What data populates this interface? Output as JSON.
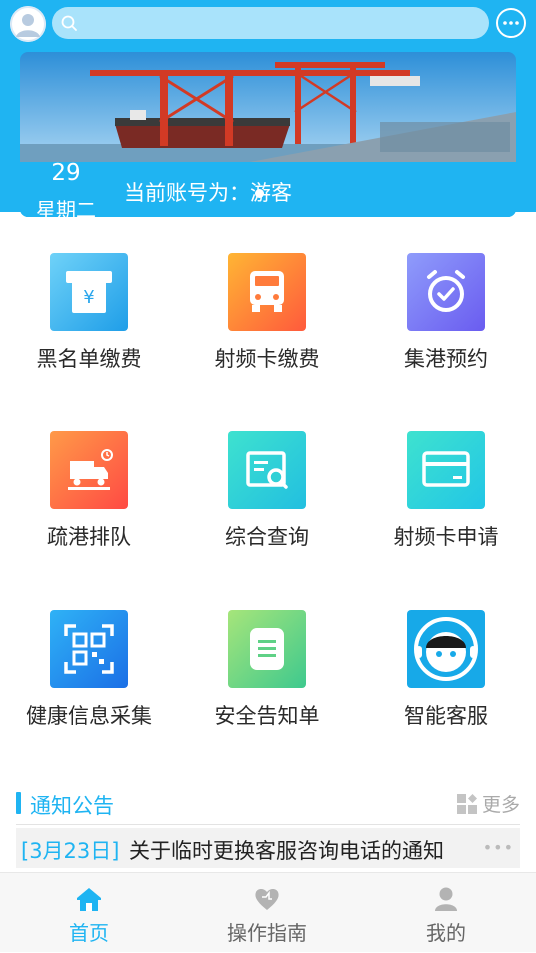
{
  "header": {
    "avatar_icon": "user-avatar-icon",
    "search": {
      "placeholder": "",
      "icon": "search-icon"
    },
    "message_icon": "chat-bubble-icon"
  },
  "banner": {
    "image": "port-crane-ship-photo",
    "date_day": "29",
    "date_weekday": "星期二",
    "account_text": "当前账号为：游客",
    "indicator_count": 2,
    "indicator_active": 0
  },
  "menu": {
    "items": [
      {
        "label": "黑名单缴费",
        "icon": "atm-yen-icon"
      },
      {
        "label": "射频卡缴费",
        "icon": "truck-icon"
      },
      {
        "label": "集港预约",
        "icon": "alarm-clock-icon"
      },
      {
        "label": "疏港排队",
        "icon": "truck-queue-icon"
      },
      {
        "label": "综合查询",
        "icon": "document-search-icon"
      },
      {
        "label": "射频卡申请",
        "icon": "card-icon"
      },
      {
        "label": "健康信息采集",
        "icon": "qr-scan-icon"
      },
      {
        "label": "安全告知单",
        "icon": "note-icon"
      },
      {
        "label": "智能客服",
        "icon": "customer-service-icon"
      }
    ]
  },
  "notice": {
    "title": "通知公告",
    "more_label": "更多",
    "more_icon": "grid-more-icon",
    "items": [
      {
        "date": "[3月23日]",
        "text": "关于临时更换客服咨询电话的通知",
        "menu": "•••"
      }
    ]
  },
  "tabbar": {
    "tabs": [
      {
        "label": "首页",
        "icon": "home-icon",
        "active": true
      },
      {
        "label": "操作指南",
        "icon": "guide-heart-icon",
        "active": false
      },
      {
        "label": "我的",
        "icon": "profile-icon",
        "active": false
      }
    ]
  },
  "colors": {
    "primary": "#1fb4f2",
    "inactive_tab": "#666666",
    "notice_date": "#1fb4f2"
  }
}
